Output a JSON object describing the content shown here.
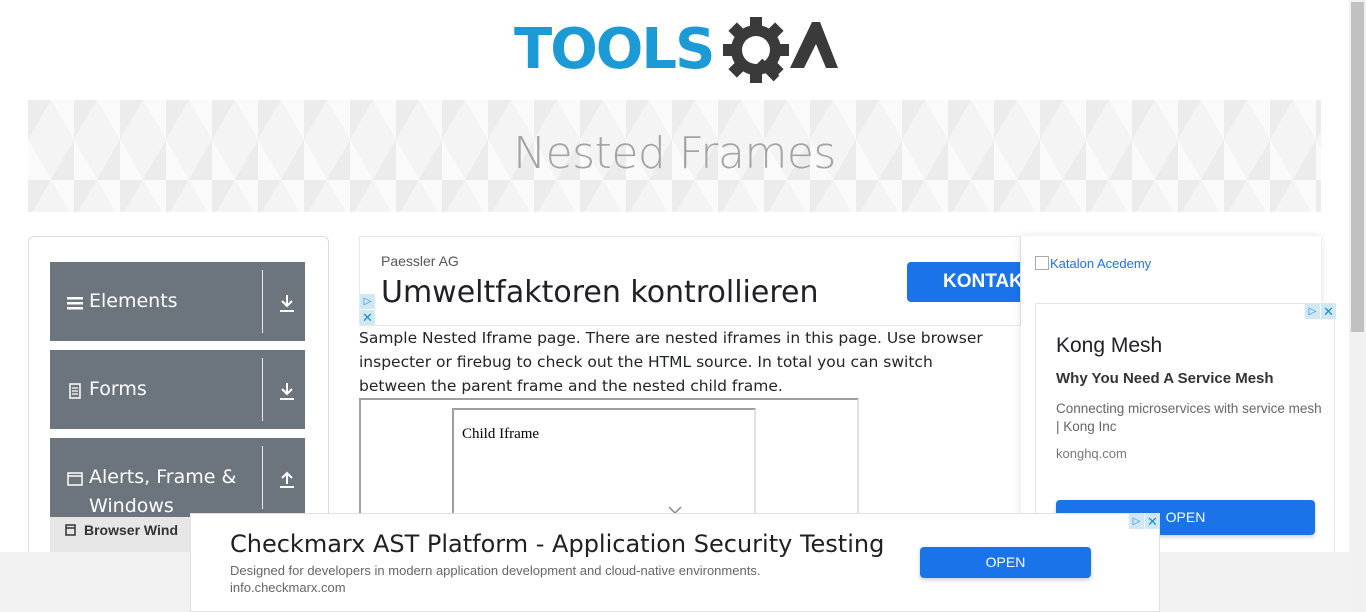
{
  "header": {
    "logo_text_primary": "TOOLS",
    "logo_text_secondary": "QA",
    "logo_primary_color": "#1b9ad6",
    "logo_secondary_color": "#3a3a3a"
  },
  "banner": {
    "title": "Nested Frames"
  },
  "sidebar": {
    "groups": [
      {
        "label": "Elements",
        "icon": "hamburger-icon",
        "arrow": "download-arrow-icon"
      },
      {
        "label": "Forms",
        "icon": "document-icon",
        "arrow": "download-arrow-icon"
      },
      {
        "label": "Alerts, Frame &",
        "label2": "Windows",
        "icon": "window-icon",
        "arrow": "upload-arrow-icon"
      }
    ],
    "subitem": {
      "label": "Browser Wind",
      "icon": "window-icon"
    },
    "group_color": "#6c757d"
  },
  "top_ad": {
    "advertiser": "Paessler AG",
    "headline": "Umweltfaktoren kontrollieren",
    "cta": "KONTAKT"
  },
  "intro": {
    "text": "Sample Nested Iframe page. There are nested iframes in this page. Use browser inspecter or firebug to check out the HTML source. In total you can switch between the parent frame and the nested child frame."
  },
  "frames": {
    "child_text": "Child Iframe"
  },
  "right_ad": {
    "image_alt": "Katalon Acedemy",
    "title": "Kong Mesh",
    "subtitle": "Why You Need A Service Mesh",
    "description": "Connecting microservices with service mesh | Kong Inc",
    "url": "konghq.com",
    "cta": "OPEN"
  },
  "bottom_ad": {
    "headline": "Checkmarx AST Platform - Application Security Testing",
    "description": "Designed for developers in modern application development and cloud-native environments.",
    "url": "info.checkmarx.com",
    "cta": "OPEN"
  },
  "ad_choices": {
    "choice_glyph": "▷",
    "close_glyph": "✕"
  },
  "accent_color": "#1a73e8"
}
